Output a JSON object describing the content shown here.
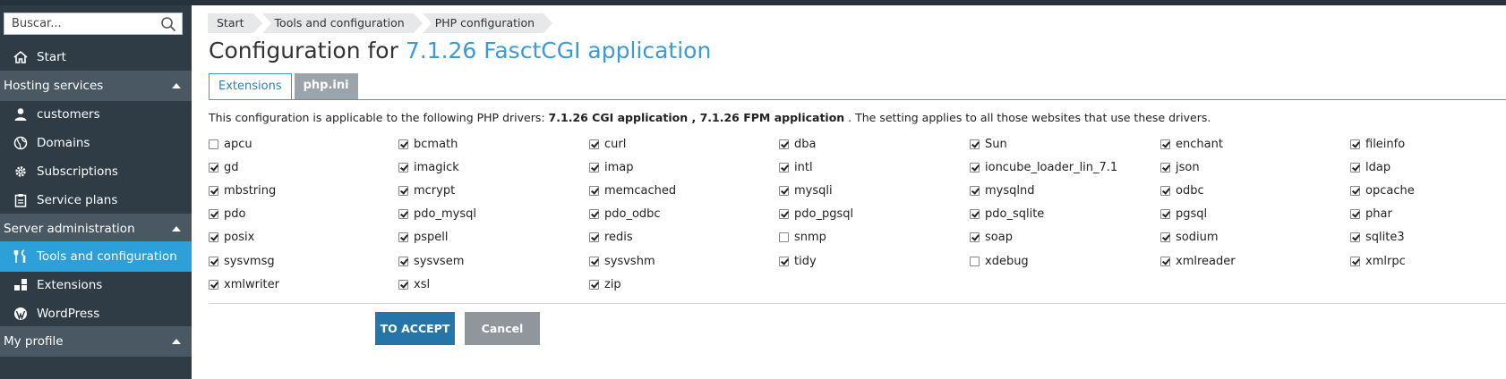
{
  "sidebar": {
    "search_placeholder": "Buscar...",
    "start": "Start",
    "section_hosting": "Hosting services",
    "hosting_items": [
      "customers",
      "Domains",
      "Subscriptions",
      "Service plans"
    ],
    "section_server": "Server administration",
    "server_items": [
      "Tools and configuration",
      "Extensions",
      "WordPress"
    ],
    "section_profile": "My profile",
    "active_color": "#2d9fd9"
  },
  "breadcrumb": [
    "Start",
    "Tools and configuration",
    "PHP configuration"
  ],
  "title": {
    "prefix": "Configuration for ",
    "highlight": "7.1.26 FasctCGI application"
  },
  "tabs": [
    "Extensions",
    "php.ini"
  ],
  "description": {
    "before": "This configuration is applicable to the following PHP drivers: ",
    "driver1": "7.1.26 CGI application",
    "sep": " , ",
    "driver2": "7.1.26 FPM application",
    "after": " . The setting applies to all those websites that use these drivers."
  },
  "extensions": [
    [
      {
        "name": "apcu",
        "checked": false
      },
      {
        "name": "bcmath",
        "checked": true
      },
      {
        "name": "curl",
        "checked": true
      },
      {
        "name": "dba",
        "checked": true
      },
      {
        "name": "Sun",
        "checked": true
      },
      {
        "name": "enchant",
        "checked": true
      },
      {
        "name": "fileinfo",
        "checked": true
      }
    ],
    [
      {
        "name": "gd",
        "checked": true
      },
      {
        "name": "imagick",
        "checked": true
      },
      {
        "name": "imap",
        "checked": true
      },
      {
        "name": "intl",
        "checked": true
      },
      {
        "name": "ioncube_loader_lin_7.1",
        "checked": true
      },
      {
        "name": "json",
        "checked": true
      },
      {
        "name": "ldap",
        "checked": true
      }
    ],
    [
      {
        "name": "mbstring",
        "checked": true
      },
      {
        "name": "mcrypt",
        "checked": true
      },
      {
        "name": "memcached",
        "checked": true
      },
      {
        "name": "mysqli",
        "checked": true
      },
      {
        "name": "mysqlnd",
        "checked": true
      },
      {
        "name": "odbc",
        "checked": true
      },
      {
        "name": "opcache",
        "checked": true
      }
    ],
    [
      {
        "name": "pdo",
        "checked": true
      },
      {
        "name": "pdo_mysql",
        "checked": true
      },
      {
        "name": "pdo_odbc",
        "checked": true
      },
      {
        "name": "pdo_pgsql",
        "checked": true
      },
      {
        "name": "pdo_sqlite",
        "checked": true
      },
      {
        "name": "pgsql",
        "checked": true
      },
      {
        "name": "phar",
        "checked": true
      }
    ],
    [
      {
        "name": "posix",
        "checked": true
      },
      {
        "name": "pspell",
        "checked": true
      },
      {
        "name": "redis",
        "checked": true
      },
      {
        "name": "snmp",
        "checked": false
      },
      {
        "name": "soap",
        "checked": true
      },
      {
        "name": "sodium",
        "checked": true
      },
      {
        "name": "sqlite3",
        "checked": true
      }
    ],
    [
      {
        "name": "sysvmsg",
        "checked": true
      },
      {
        "name": "sysvsem",
        "checked": true
      },
      {
        "name": "sysvshm",
        "checked": true
      },
      {
        "name": "tidy",
        "checked": true
      },
      {
        "name": "xdebug",
        "checked": false
      },
      {
        "name": "xmlreader",
        "checked": true
      },
      {
        "name": "xmlrpc",
        "checked": true
      }
    ],
    [
      {
        "name": "xmlwriter",
        "checked": true
      },
      {
        "name": "xsl",
        "checked": true
      },
      {
        "name": "zip",
        "checked": true
      }
    ]
  ],
  "buttons": {
    "accept": "TO ACCEPT",
    "cancel": "Cancel"
  }
}
